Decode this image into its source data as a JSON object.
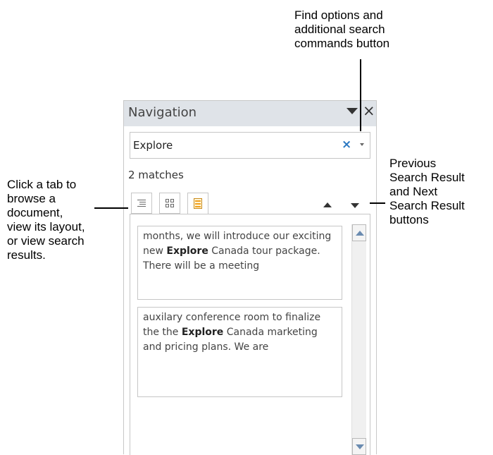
{
  "callouts": {
    "find_options": [
      "Find options and",
      "additional search",
      "commands button"
    ],
    "prev_next": [
      "Previous",
      "Search Result",
      "and Next",
      "Search Result",
      "buttons"
    ],
    "tabs": [
      "Click a tab to",
      "browse a",
      "document,",
      "view its layout,",
      "or view search",
      "results."
    ]
  },
  "pane": {
    "title": "Navigation",
    "dropdown_icon": "triangle-down-icon",
    "close_glyph": "×",
    "search": {
      "value": "Explore",
      "clear_glyph": "×"
    },
    "match_count": "2 matches",
    "tabs": [
      {
        "name": "headings",
        "icon": "headings-list-icon"
      },
      {
        "name": "pages",
        "icon": "page-thumbnails-icon"
      },
      {
        "name": "results",
        "icon": "search-results-icon",
        "active": true
      }
    ],
    "results": [
      {
        "before": "months, we will introduce our exciting new ",
        "match": "Explore",
        "after": " Canada tour package. There will be a meeting"
      },
      {
        "before": "auxilary conference room to finalize the the ",
        "match": "Explore",
        "after": " Canada marketing and pricing plans. We are"
      }
    ]
  }
}
